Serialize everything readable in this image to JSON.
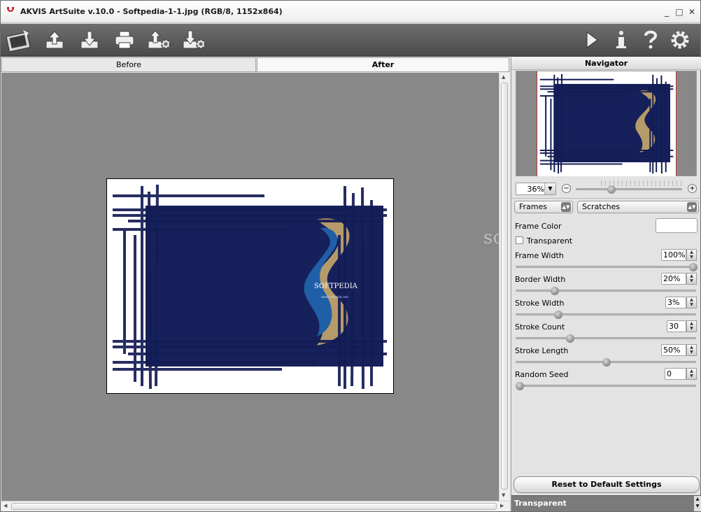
{
  "window": {
    "title": "AKVIS ArtSuite v.10.0 - Softpedia-1-1.jpg (RGB/8, 1152x864)"
  },
  "tabs": [
    {
      "label": "Before",
      "active": false
    },
    {
      "label": "After",
      "active": true
    }
  ],
  "toolbar": {
    "items": [
      "app-logo-icon",
      "open-icon",
      "save-icon",
      "print-icon",
      "import-preset-icon",
      "export-preset-icon",
      "run-icon",
      "info-icon",
      "help-icon",
      "settings-icon"
    ]
  },
  "navigator": {
    "title": "Navigator",
    "zoom": "36%",
    "zoom_minus": "−",
    "zoom_plus": "+"
  },
  "settings": {
    "effect_dropdown": "Frames",
    "style_dropdown": "Scratches",
    "frame_color_label": "Frame Color",
    "frame_color": "#ffffff",
    "transparent_label": "Transparent",
    "params": [
      {
        "label": "Frame Width",
        "value": "100%",
        "level": 1.0
      },
      {
        "label": "Border Width",
        "value": "20%",
        "level": 0.2
      },
      {
        "label": "Stroke Width",
        "value": "3%",
        "level": 0.22
      },
      {
        "label": "Stroke Count",
        "value": "30",
        "level": 0.29
      },
      {
        "label": "Stroke Length",
        "value": "50%",
        "level": 0.5
      },
      {
        "label": "Random Seed",
        "value": "0",
        "level": 0.0
      }
    ],
    "reset_label": "Reset to Default Settings"
  },
  "status": {
    "text": "Transparent"
  },
  "image": {
    "inner_text": "SOFTPEDIA",
    "inner_url": "www.softpedia.com",
    "watermark": "SOFTPEDIA"
  },
  "colors": {
    "toolbar": "#5a5a5a",
    "canvas": "#888888",
    "frame": "#ffffff",
    "stroke": "#1a2560"
  }
}
